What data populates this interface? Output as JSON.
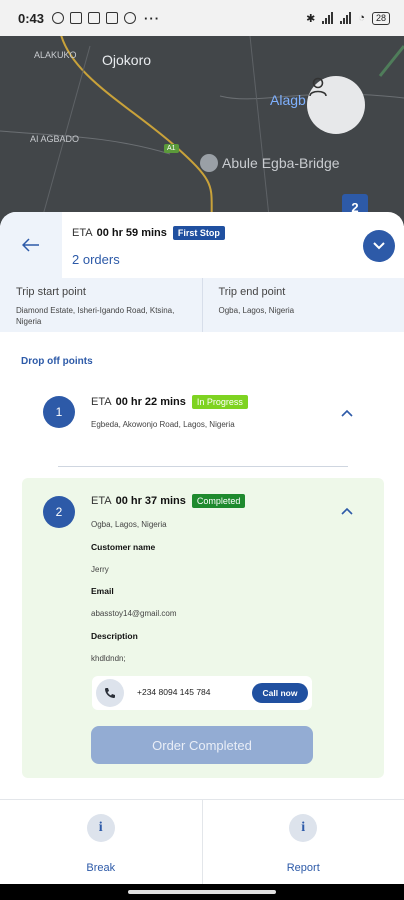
{
  "status_bar": {
    "time": "0:43",
    "more": "···",
    "battery": "28"
  },
  "map": {
    "labels": {
      "ojokoro": "Ojokoro",
      "alakuko": "ALAKUKO",
      "agbado": "AI AGBADO",
      "alagbo": "Alagb",
      "abule": "Abule Egba-Bridge",
      "road": "A1"
    },
    "marker": "2"
  },
  "header": {
    "eta_label": "ETA",
    "eta_value": "00 hr 59 mins",
    "badge": "First Stop",
    "orders": "2 orders"
  },
  "trip": {
    "start_title": "Trip start point",
    "start_value": "Diamond Estate, Isheri-Igando Road, Ktsina, Nigeria",
    "end_title": "Trip end point",
    "end_value": "Ogba, Lagos, Nigeria"
  },
  "drop_title": "Drop off points",
  "stops": [
    {
      "number": "1",
      "eta_label": "ETA",
      "eta_value": "00 hr 22 mins",
      "status": "In Progress",
      "address": "Egbeda, Akowonjo Road, Lagos, Nigeria"
    },
    {
      "number": "2",
      "eta_label": "ETA",
      "eta_value": "00 hr 37 mins",
      "status": "Completed",
      "address": "Ogba, Lagos, Nigeria",
      "customer_label": "Customer name",
      "customer_value": "Jerry",
      "email_label": "Email",
      "email_value": "abasstoy14@gmail.com",
      "description_label": "Description",
      "description_value": "khdldndn;",
      "phone": "+234 8094 145 784",
      "call_label": "Call now",
      "order_button": "Order Completed"
    }
  ],
  "bottom": {
    "break_label": "Break",
    "report_label": "Report"
  },
  "colors": {
    "primary": "#2d5aa8",
    "in_progress": "#7ed321",
    "completed": "#1e8a2e",
    "completed_card_bg": "#eef8e9"
  }
}
